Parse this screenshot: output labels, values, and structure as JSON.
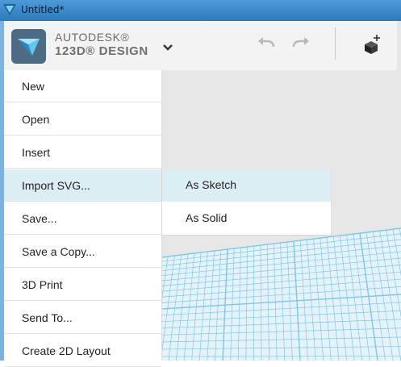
{
  "window": {
    "title": "Untitled*",
    "icon": "autodesk-triangle-icon"
  },
  "toolbar": {
    "brand_line1": "AUTODESK®",
    "brand_line2": "123D® DESIGN",
    "logo_icon": "123d-cube-logo",
    "menu_icon": "chevron-down-icon",
    "undo_icon": "undo-arrow-icon",
    "redo_icon": "redo-arrow-icon",
    "primitive_icon": "add-box-icon"
  },
  "main_menu": {
    "items": [
      {
        "label": "New"
      },
      {
        "label": "Open"
      },
      {
        "label": "Insert"
      },
      {
        "label": "Import SVG..."
      },
      {
        "label": "Save..."
      },
      {
        "label": "Save a Copy..."
      },
      {
        "label": "3D Print"
      },
      {
        "label": "Send To..."
      },
      {
        "label": "Create 2D Layout"
      }
    ],
    "active_item": "Import SVG..."
  },
  "submenu": {
    "items": [
      {
        "label": "As Sketch"
      },
      {
        "label": "As Solid"
      }
    ],
    "active_item": "As Sketch"
  },
  "colors": {
    "highlight": "#dcedf4",
    "grid_line": "#7fc6e6",
    "title_bar": "#3a86c9",
    "viewport_bg": "#e7e7e7"
  }
}
